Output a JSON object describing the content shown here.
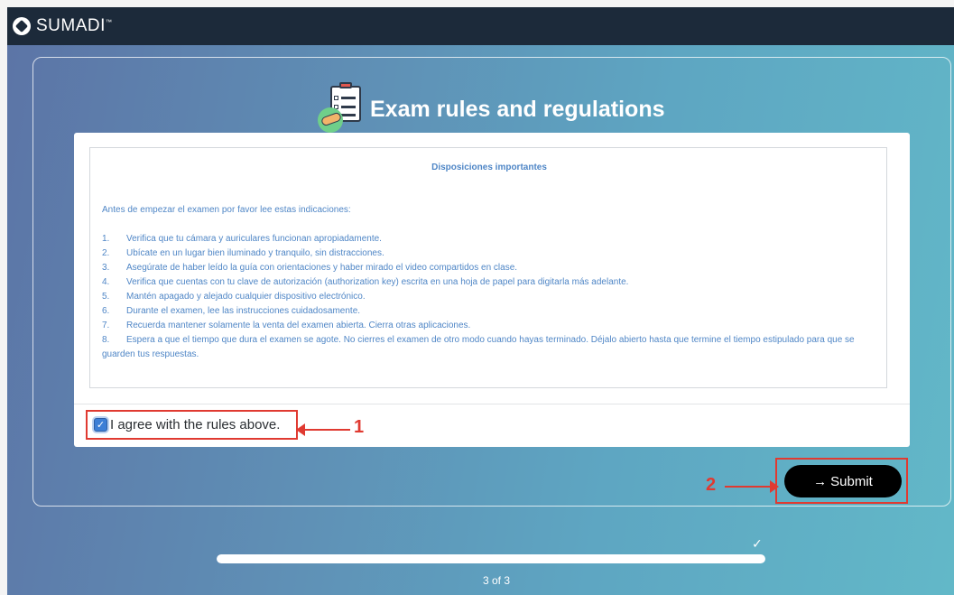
{
  "header": {
    "brand": "SUMADI",
    "brand_mark": "™"
  },
  "page": {
    "title": "Exam rules and regulations",
    "title_icon": "clipboard-handshake-icon"
  },
  "rules": {
    "heading": "Disposiciones importantes",
    "intro": "Antes de empezar el examen por favor lee estas indicaciones:",
    "items": [
      {
        "num": "1.",
        "text": "Verifica que tu cámara y auriculares funcionan apropiadamente."
      },
      {
        "num": "2.",
        "text": "Ubícate en un lugar bien iluminado y tranquilo, sin distracciones."
      },
      {
        "num": "3.",
        "text": "Asegúrate de haber leído la guía con orientaciones y haber mirado el video compartidos en clase."
      },
      {
        "num": "4.",
        "text": "Verifica que cuentas con tu clave de autorización (authorization key) escrita en una hoja de papel para digitarla más adelante."
      },
      {
        "num": "5.",
        "text": "Mantén apagado y alejado cualquier dispositivo electrónico."
      },
      {
        "num": "6.",
        "text": "Durante el examen, lee las instrucciones cuidadosamente."
      },
      {
        "num": "7.",
        "text": "Recuerda mantener solamente la venta del examen abierta. Cierra otras aplicaciones."
      },
      {
        "num": "8.",
        "text": "Espera a que el tiempo que dura el examen se agote. No cierres el examen de otro modo cuando hayas terminado. Déjalo abierto hasta que termine el tiempo estipulado para que se guarden tus respuestas."
      }
    ]
  },
  "agreement": {
    "label": "I agree with the rules above.",
    "checked": true
  },
  "annotations": {
    "marker_1": "1",
    "marker_2": "2",
    "color": "#e03a31"
  },
  "actions": {
    "submit_label": "Submit",
    "submit_icon": "arrow-right-icon"
  },
  "progress": {
    "label": "3 of 3",
    "fraction": 1.0,
    "complete_icon": "checkmark-icon"
  },
  "colors": {
    "topbar": "#1c2a3a",
    "rules_text": "#4f86c6",
    "checkbox": "#3d7fd6"
  }
}
